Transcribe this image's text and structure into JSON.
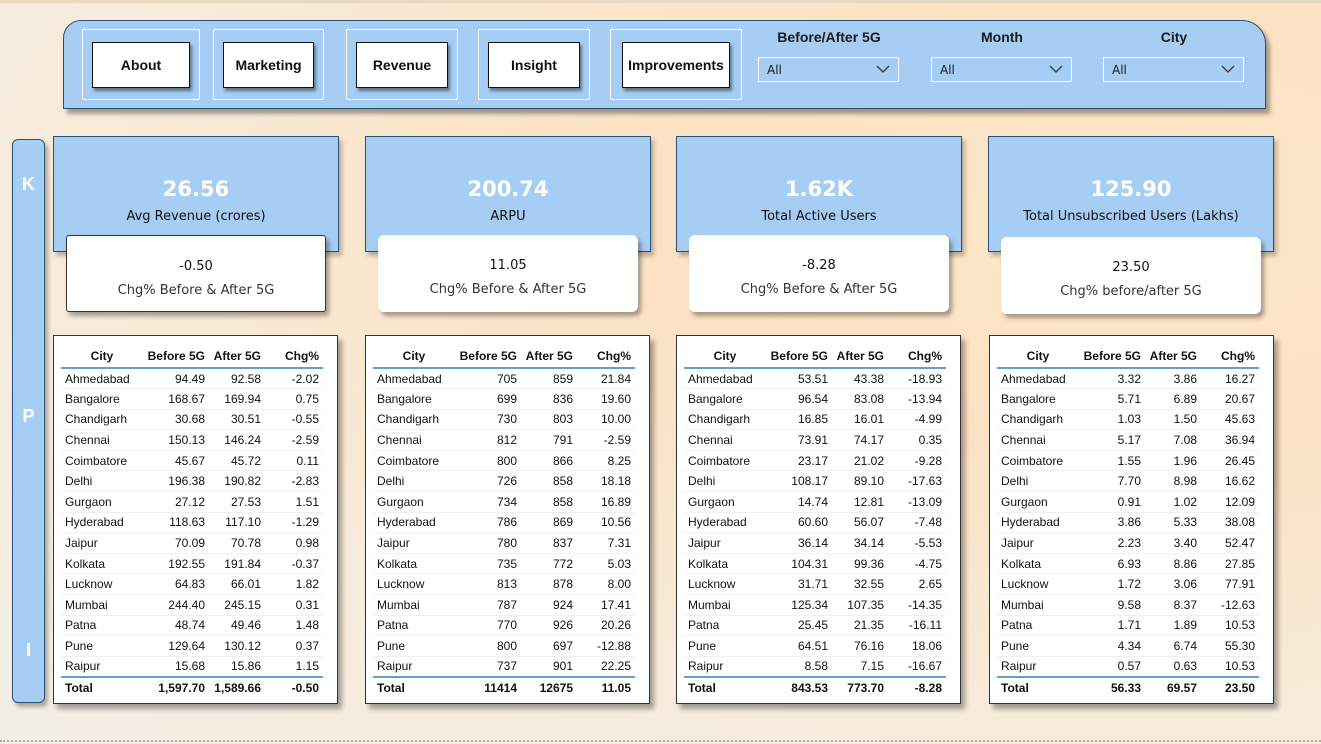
{
  "nav": {
    "buttons": [
      "About",
      "Marketing",
      "Revenue",
      "Insight",
      "Improvements"
    ]
  },
  "filters": [
    {
      "title": "Before/After 5G",
      "value": "All"
    },
    {
      "title": "Month",
      "value": "All"
    },
    {
      "title": "City",
      "value": "All"
    }
  ],
  "kpi_letters": [
    "K",
    "P",
    "I"
  ],
  "cards": [
    {
      "value": "26.56",
      "label": "Avg Revenue (crores)",
      "chg_value": "-0.50",
      "chg_label": "Chg% Before & After 5G"
    },
    {
      "value": "200.74",
      "label": "ARPU",
      "chg_value": "11.05",
      "chg_label": "Chg% Before & After 5G"
    },
    {
      "value": "1.62K",
      "label": "Total Active Users",
      "chg_value": "-8.28",
      "chg_label": "Chg% Before & After 5G"
    },
    {
      "value": "125.90",
      "label": "Total Unsubscribed Users (Lakhs)",
      "chg_value": "23.50",
      "chg_label": "Chg% before/after 5G"
    }
  ],
  "table_headers": [
    "City",
    "Before 5G",
    "After 5G",
    "Chg%"
  ],
  "cities": [
    "Ahmedabad",
    "Bangalore",
    "Chandigarh",
    "Chennai",
    "Coimbatore",
    "Delhi",
    "Gurgaon",
    "Hyderabad",
    "Jaipur",
    "Kolkata",
    "Lucknow",
    "Mumbai",
    "Patna",
    "Pune",
    "Raipur"
  ],
  "total_label": "Total",
  "tables": [
    {
      "rows": [
        [
          "94.49",
          "92.58",
          "-2.02"
        ],
        [
          "168.67",
          "169.94",
          "0.75"
        ],
        [
          "30.68",
          "30.51",
          "-0.55"
        ],
        [
          "150.13",
          "146.24",
          "-2.59"
        ],
        [
          "45.67",
          "45.72",
          "0.11"
        ],
        [
          "196.38",
          "190.82",
          "-2.83"
        ],
        [
          "27.12",
          "27.53",
          "1.51"
        ],
        [
          "118.63",
          "117.10",
          "-1.29"
        ],
        [
          "70.09",
          "70.78",
          "0.98"
        ],
        [
          "192.55",
          "191.84",
          "-0.37"
        ],
        [
          "64.83",
          "66.01",
          "1.82"
        ],
        [
          "244.40",
          "245.15",
          "0.31"
        ],
        [
          "48.74",
          "49.46",
          "1.48"
        ],
        [
          "129.64",
          "130.12",
          "0.37"
        ],
        [
          "15.68",
          "15.86",
          "1.15"
        ]
      ],
      "total": [
        "1,597.70",
        "1,589.66",
        "-0.50"
      ]
    },
    {
      "rows": [
        [
          "705",
          "859",
          "21.84"
        ],
        [
          "699",
          "836",
          "19.60"
        ],
        [
          "730",
          "803",
          "10.00"
        ],
        [
          "812",
          "791",
          "-2.59"
        ],
        [
          "800",
          "866",
          "8.25"
        ],
        [
          "726",
          "858",
          "18.18"
        ],
        [
          "734",
          "858",
          "16.89"
        ],
        [
          "786",
          "869",
          "10.56"
        ],
        [
          "780",
          "837",
          "7.31"
        ],
        [
          "735",
          "772",
          "5.03"
        ],
        [
          "813",
          "878",
          "8.00"
        ],
        [
          "787",
          "924",
          "17.41"
        ],
        [
          "770",
          "926",
          "20.26"
        ],
        [
          "800",
          "697",
          "-12.88"
        ],
        [
          "737",
          "901",
          "22.25"
        ]
      ],
      "total": [
        "11414",
        "12675",
        "11.05"
      ]
    },
    {
      "rows": [
        [
          "53.51",
          "43.38",
          "-18.93"
        ],
        [
          "96.54",
          "83.08",
          "-13.94"
        ],
        [
          "16.85",
          "16.01",
          "-4.99"
        ],
        [
          "73.91",
          "74.17",
          "0.35"
        ],
        [
          "23.17",
          "21.02",
          "-9.28"
        ],
        [
          "108.17",
          "89.10",
          "-17.63"
        ],
        [
          "14.74",
          "12.81",
          "-13.09"
        ],
        [
          "60.60",
          "56.07",
          "-7.48"
        ],
        [
          "36.14",
          "34.14",
          "-5.53"
        ],
        [
          "104.31",
          "99.36",
          "-4.75"
        ],
        [
          "31.71",
          "32.55",
          "2.65"
        ],
        [
          "125.34",
          "107.35",
          "-14.35"
        ],
        [
          "25.45",
          "21.35",
          "-16.11"
        ],
        [
          "64.51",
          "76.16",
          "18.06"
        ],
        [
          "8.58",
          "7.15",
          "-16.67"
        ]
      ],
      "total": [
        "843.53",
        "773.70",
        "-8.28"
      ]
    },
    {
      "rows": [
        [
          "3.32",
          "3.86",
          "16.27"
        ],
        [
          "5.71",
          "6.89",
          "20.67"
        ],
        [
          "1.03",
          "1.50",
          "45.63"
        ],
        [
          "5.17",
          "7.08",
          "36.94"
        ],
        [
          "1.55",
          "1.96",
          "26.45"
        ],
        [
          "7.70",
          "8.98",
          "16.62"
        ],
        [
          "0.91",
          "1.02",
          "12.09"
        ],
        [
          "3.86",
          "5.33",
          "38.08"
        ],
        [
          "2.23",
          "3.40",
          "52.47"
        ],
        [
          "6.93",
          "8.86",
          "27.85"
        ],
        [
          "1.72",
          "3.06",
          "77.91"
        ],
        [
          "9.58",
          "8.37",
          "-12.63"
        ],
        [
          "1.71",
          "1.89",
          "10.53"
        ],
        [
          "4.34",
          "6.74",
          "55.30"
        ],
        [
          "0.57",
          "0.63",
          "10.53"
        ]
      ],
      "total": [
        "56.33",
        "69.57",
        "23.50"
      ]
    }
  ],
  "colors": {
    "panel_blue": "#a6cdf3",
    "border_navy": "#2d4f73",
    "table_rule": "#6b9ed0"
  }
}
